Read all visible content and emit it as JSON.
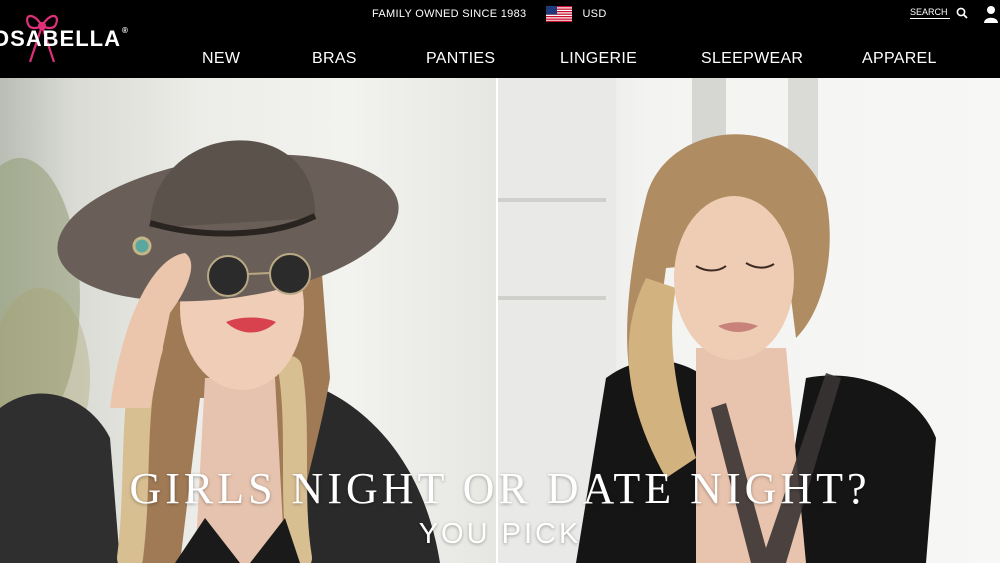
{
  "header": {
    "logo_text": "OSABELLA",
    "logo_reg": "®",
    "tagline": "FAMILY OWNED SINCE 1983",
    "currency": "USD",
    "search_label": "SEARCH"
  },
  "nav": {
    "items": [
      {
        "label": "NEW"
      },
      {
        "label": "BRAS"
      },
      {
        "label": "PANTIES"
      },
      {
        "label": "LINGERIE"
      },
      {
        "label": "SLEEPWEAR"
      },
      {
        "label": "APPAREL"
      }
    ]
  },
  "hero": {
    "title": "GIRLS NIGHT OR DATE NIGHT?",
    "subtitle": "YOU PICK"
  },
  "colors": {
    "header_bg": "#000000",
    "header_text": "#ffffff",
    "logo_bow": "#e0307a"
  }
}
